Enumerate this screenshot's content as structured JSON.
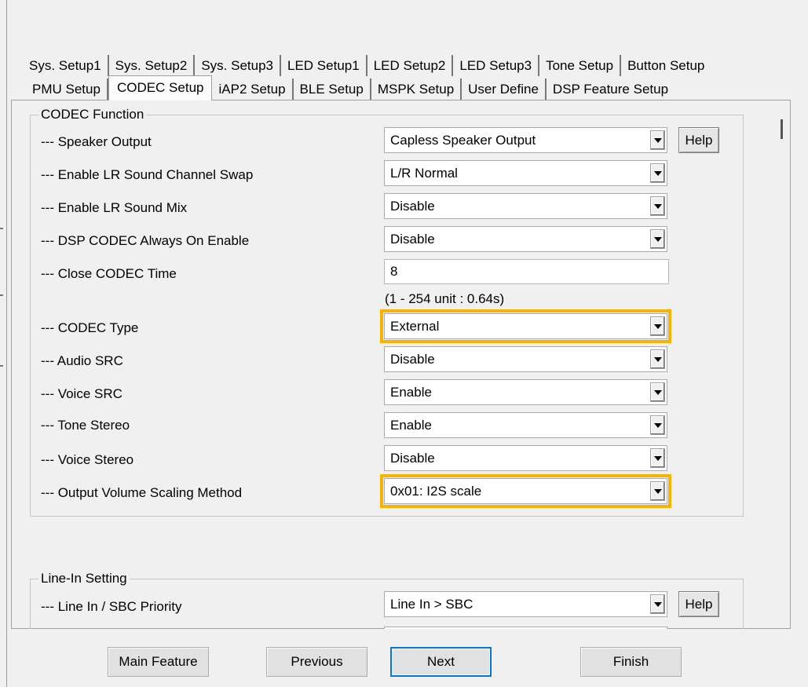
{
  "tabs_row1": [
    "Sys. Setup1",
    "Sys. Setup2",
    "Sys. Setup3",
    "LED Setup1",
    "LED Setup2",
    "LED Setup3",
    "Tone Setup",
    "Button Setup"
  ],
  "tabs_row2": [
    "PMU Setup",
    "CODEC Setup",
    "iAP2 Setup",
    "BLE Setup",
    "MSPK Setup",
    "User Define",
    "DSP Feature Setup"
  ],
  "active_tab": "CODEC Setup",
  "codec": {
    "title": "CODEC Function",
    "speaker_output": {
      "label": "--- Speaker Output",
      "value": "Capless Speaker Output"
    },
    "lr_swap": {
      "label": "--- Enable LR Sound Channel Swap",
      "value": "L/R Normal"
    },
    "lr_mix": {
      "label": "--- Enable LR Sound Mix",
      "value": "Disable"
    },
    "dsp_always_on": {
      "label": "--- DSP CODEC Always On Enable",
      "value": "Disable"
    },
    "close_time": {
      "label": "--- Close CODEC Time",
      "value": "8",
      "hint": "(1 - 254 unit : 0.64s)"
    },
    "codec_type": {
      "label": "--- CODEC Type",
      "value": "External"
    },
    "audio_src": {
      "label": "--- Audio SRC",
      "value": "Disable"
    },
    "voice_src": {
      "label": "--- Voice SRC",
      "value": "Enable"
    },
    "tone_stereo": {
      "label": "--- Tone Stereo",
      "value": "Enable"
    },
    "voice_stereo": {
      "label": "--- Voice Stereo",
      "value": "Disable"
    },
    "volume_scaling": {
      "label": "--- Output Volume Scaling Method",
      "value": "0x01: I2S scale"
    },
    "help_label": "Help"
  },
  "line_in": {
    "title": "Line-In Setting",
    "priority": {
      "label": "--- Line In / SBC Priority",
      "value": "Line In > SBC"
    },
    "help_label": "Help"
  },
  "buttons": {
    "main_feature": "Main Feature",
    "previous": "Previous",
    "next": "Next",
    "finish": "Finish"
  },
  "colors": {
    "highlight": "#f5b400",
    "default_button_border": "#0078d7",
    "window_bg": "#f0f0f0"
  }
}
